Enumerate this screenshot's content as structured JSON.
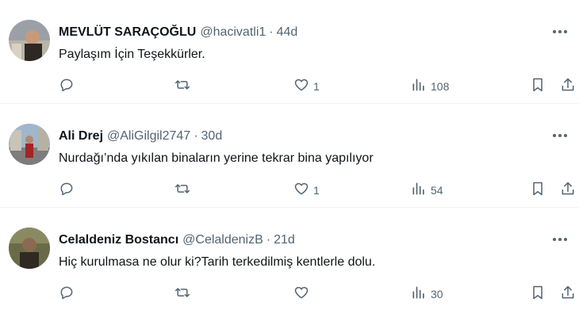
{
  "tweets": [
    {
      "name": "MEVLÜT SARAÇOĞLU",
      "handle": "@hacivatli1",
      "time": "44d",
      "text": "Paylaşım İçin Teşekkürler.",
      "likes": "1",
      "views": "108",
      "avatar_colors": [
        "#8a8f96",
        "#c9c2b6",
        "#3b2a22"
      ]
    },
    {
      "name": "Ali Drej",
      "handle": "@AliGilgil2747",
      "time": "30d",
      "text": "Nurdağı’nda yıkılan binaların yerine tekrar bina yapılıyor",
      "likes": "1",
      "views": "54",
      "avatar_colors": [
        "#6a8db0",
        "#9aa3a8",
        "#b02a2a"
      ]
    },
    {
      "name": "Celaldeniz Bostancı",
      "handle": "@CelaldenizB",
      "time": "21d",
      "text": "Hiç kurulmasa ne olur ki?Tarih terkedilmiş kentlerle dolu.",
      "likes": "",
      "views": "30",
      "avatar_colors": [
        "#5b5a3c",
        "#7a6a50",
        "#2f2a22"
      ]
    }
  ],
  "separator": "·",
  "icons": {
    "reply": "reply-icon",
    "retweet": "retweet-icon",
    "like": "heart-icon",
    "views": "views-icon",
    "bookmark": "bookmark-icon",
    "share": "share-icon",
    "more": "more-icon"
  },
  "colors": {
    "text": "#0f1419",
    "secondary": "#536471",
    "divider": "#eff3f4"
  }
}
